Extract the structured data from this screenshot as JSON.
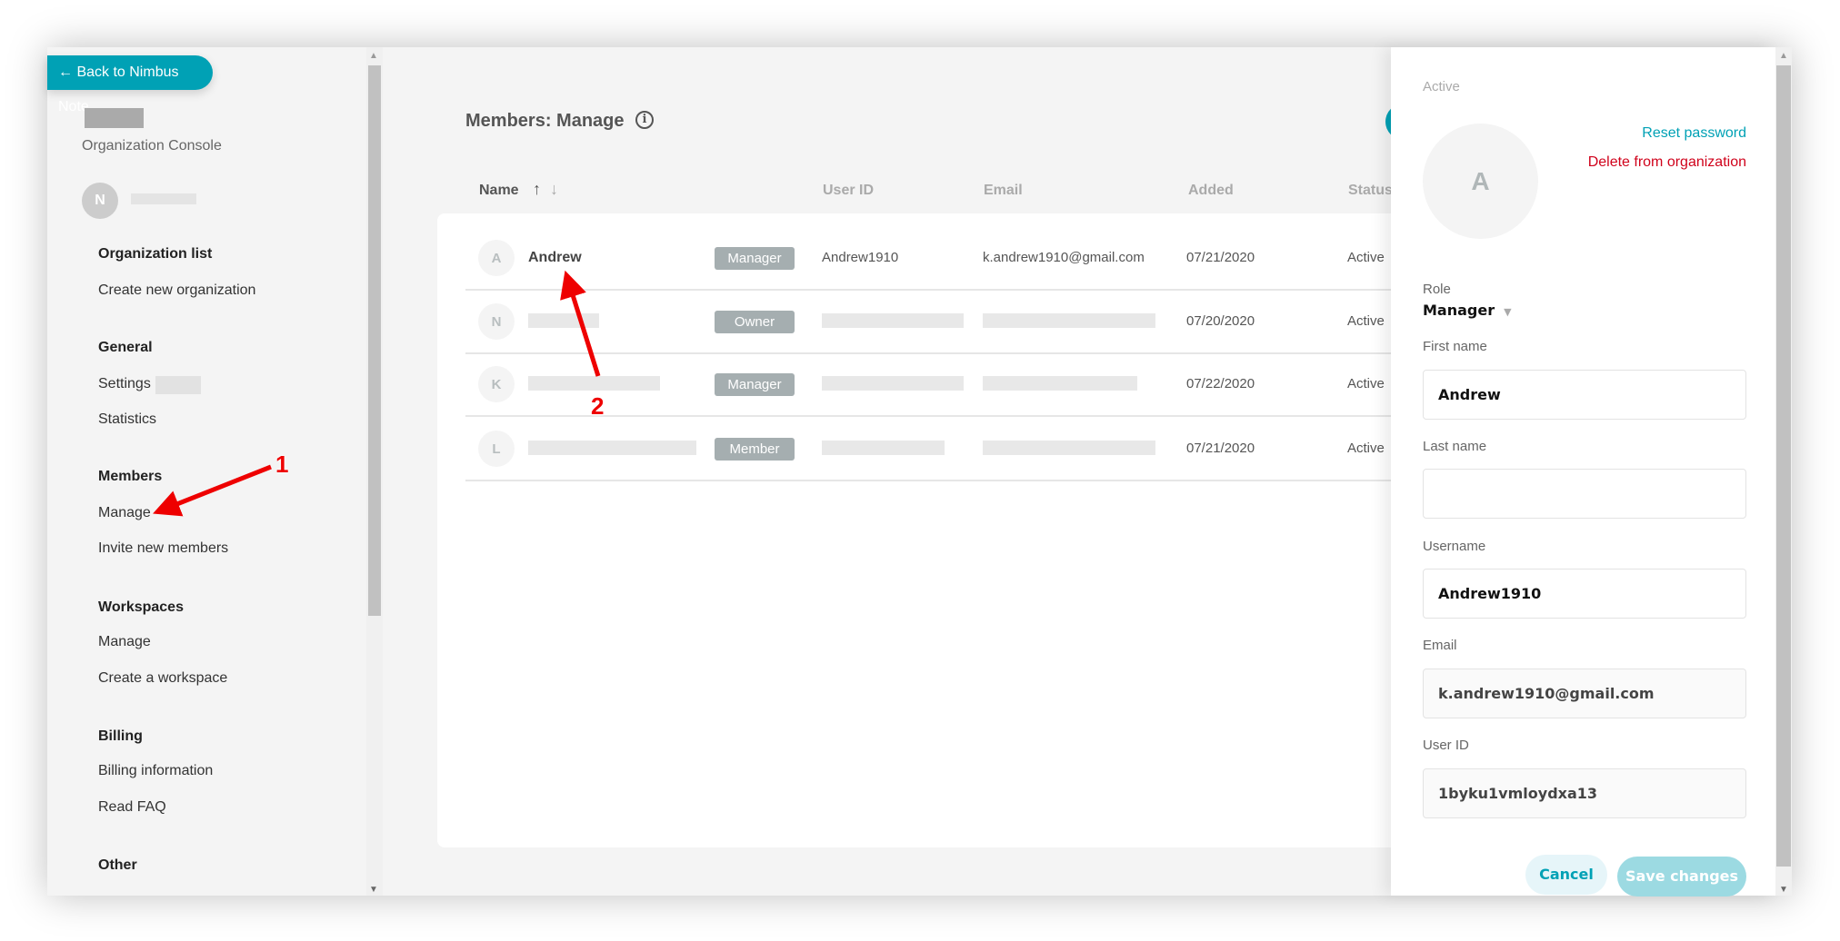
{
  "sidebar": {
    "back_label": "← Back to Nimbus Note",
    "console_label": "Organization Console",
    "user_initial": "N",
    "sections": [
      {
        "title": "Organization list",
        "items": [
          "Create new organization"
        ]
      },
      {
        "title": "General",
        "items": [
          "Settings",
          "Statistics"
        ]
      },
      {
        "title": "Members",
        "items": [
          "Manage",
          "Invite new members"
        ]
      },
      {
        "title": "Workspaces",
        "items": [
          "Manage",
          "Create a workspace"
        ]
      },
      {
        "title": "Billing",
        "items": [
          "Billing information",
          "Read FAQ"
        ]
      },
      {
        "title": "Other",
        "items": []
      }
    ]
  },
  "main": {
    "title": "Members: Manage",
    "columns": {
      "name": "Name",
      "user_id": "User ID",
      "email": "Email",
      "added": "Added",
      "status": "Status"
    },
    "rows": [
      {
        "initial": "A",
        "name": "Andrew",
        "role": "Manager",
        "user_id": "Andrew1910",
        "email": "k.andrew1910@gmail.com",
        "added": "07/21/2020",
        "status": "Active"
      },
      {
        "initial": "N",
        "name": "",
        "role": "Owner",
        "user_id": "",
        "email": "",
        "added": "07/20/2020",
        "status": "Active"
      },
      {
        "initial": "K",
        "name": "",
        "role": "Manager",
        "user_id": "",
        "email": "",
        "added": "07/22/2020",
        "status": "Active"
      },
      {
        "initial": "L",
        "name": "",
        "role": "Member",
        "user_id": "",
        "email": "",
        "added": "07/21/2020",
        "status": "Active"
      }
    ]
  },
  "panel": {
    "status": "Active",
    "initial": "A",
    "reset_password": "Reset password",
    "delete": "Delete from organization",
    "role_label": "Role",
    "role_value": "Manager",
    "first_name_label": "First name",
    "first_name": "Andrew",
    "last_name_label": "Last name",
    "last_name": "",
    "username_label": "Username",
    "username": "Andrew1910",
    "email_label": "Email",
    "email": "k.andrew1910@gmail.com",
    "user_id_label": "User ID",
    "user_id": "1byku1vmloydxa13",
    "cancel": "Cancel",
    "save": "Save changes"
  },
  "annotations": {
    "one": "1",
    "two": "2",
    "color": "#e00000"
  },
  "colors": {
    "accent": "#00a1b5",
    "danger": "#d0021b"
  }
}
